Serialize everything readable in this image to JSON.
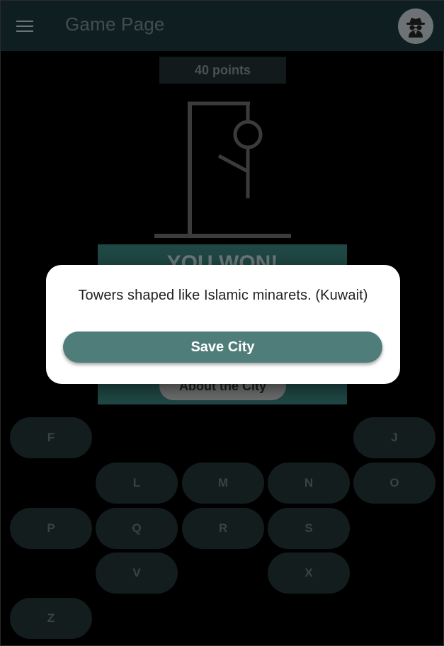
{
  "app_bar": {
    "title": "Game Page",
    "menu_icon": "menu-icon",
    "avatar_icon": "spy-icon"
  },
  "game": {
    "points_label": "40 points",
    "result_text": "YOU WON!",
    "about_button_label": "About the City"
  },
  "keyboard": [
    {
      "letter": "F"
    },
    {
      "letter": "J"
    },
    {
      "letter": "L"
    },
    {
      "letter": "M"
    },
    {
      "letter": "N"
    },
    {
      "letter": "O"
    },
    {
      "letter": "P"
    },
    {
      "letter": "Q"
    },
    {
      "letter": "R"
    },
    {
      "letter": "S"
    },
    {
      "letter": "V"
    },
    {
      "letter": "X"
    },
    {
      "letter": "Z"
    }
  ],
  "dialog": {
    "message": "Towers shaped like Islamic minarets. (Kuwait)",
    "save_button_label": "Save City"
  },
  "colors": {
    "appbar": "#0f1e21",
    "accent": "#4f7d79",
    "won_panel": "#1f4744"
  }
}
